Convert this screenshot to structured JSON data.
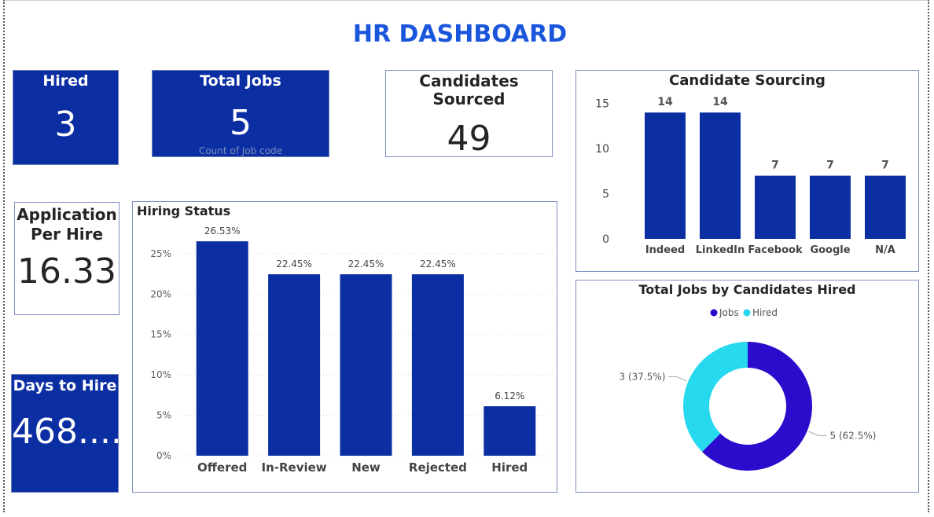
{
  "header": {
    "title": "HR DASHBOARD"
  },
  "kpis": {
    "hired": {
      "label": "Hired",
      "value": "3"
    },
    "total_jobs": {
      "label": "Total Jobs",
      "value": "5",
      "sublabel": "Count of Job code"
    },
    "candidates_sourced": {
      "label": "Candidates Sourced",
      "value": "49"
    },
    "application_per_hire": {
      "label_line1": "Application",
      "label_line2": "Per Hire",
      "value": "16.33"
    },
    "days_to_hire": {
      "label": "Days to Hire",
      "value": "468...."
    }
  },
  "colors": {
    "bar": "#0b2fa3",
    "jobs": "#2b0ccc",
    "hired": "#27d9ef",
    "title": "#1a56db"
  },
  "chart_data": [
    {
      "id": "hiring-status",
      "type": "bar",
      "title": "Hiring Status",
      "categories": [
        "Offered",
        "In-Review",
        "New",
        "Rejected",
        "Hired"
      ],
      "values": [
        26.53,
        22.45,
        22.45,
        22.45,
        6.12
      ],
      "data_labels": [
        "26.53%",
        "22.45%",
        "22.45%",
        "22.45%",
        "6.12%"
      ],
      "y_ticks": [
        0,
        5,
        10,
        15,
        20,
        25
      ],
      "y_tick_labels": [
        "0%",
        "5%",
        "10%",
        "15%",
        "20%",
        "25%"
      ],
      "ylim": [
        0,
        28
      ],
      "grid": true
    },
    {
      "id": "candidate-sourcing",
      "type": "bar",
      "title": "Candidate Sourcing",
      "categories": [
        "Indeed",
        "LinkedIn",
        "Facebook",
        "Google",
        "N/A"
      ],
      "values": [
        14,
        14,
        7,
        7,
        7
      ],
      "y_ticks": [
        0,
        5,
        10,
        15
      ],
      "ylim": [
        0,
        15.5
      ],
      "grid": false
    },
    {
      "id": "jobs-vs-hired",
      "type": "pie",
      "title": "Total Jobs by Candidates Hired",
      "legend": [
        "Jobs",
        "Hired"
      ],
      "legend_position": "top",
      "slices": [
        {
          "name": "Jobs",
          "value": 5,
          "label": "5 (62.5%)"
        },
        {
          "name": "Hired",
          "value": 3,
          "label": "3 (37.5%)"
        }
      ]
    }
  ]
}
